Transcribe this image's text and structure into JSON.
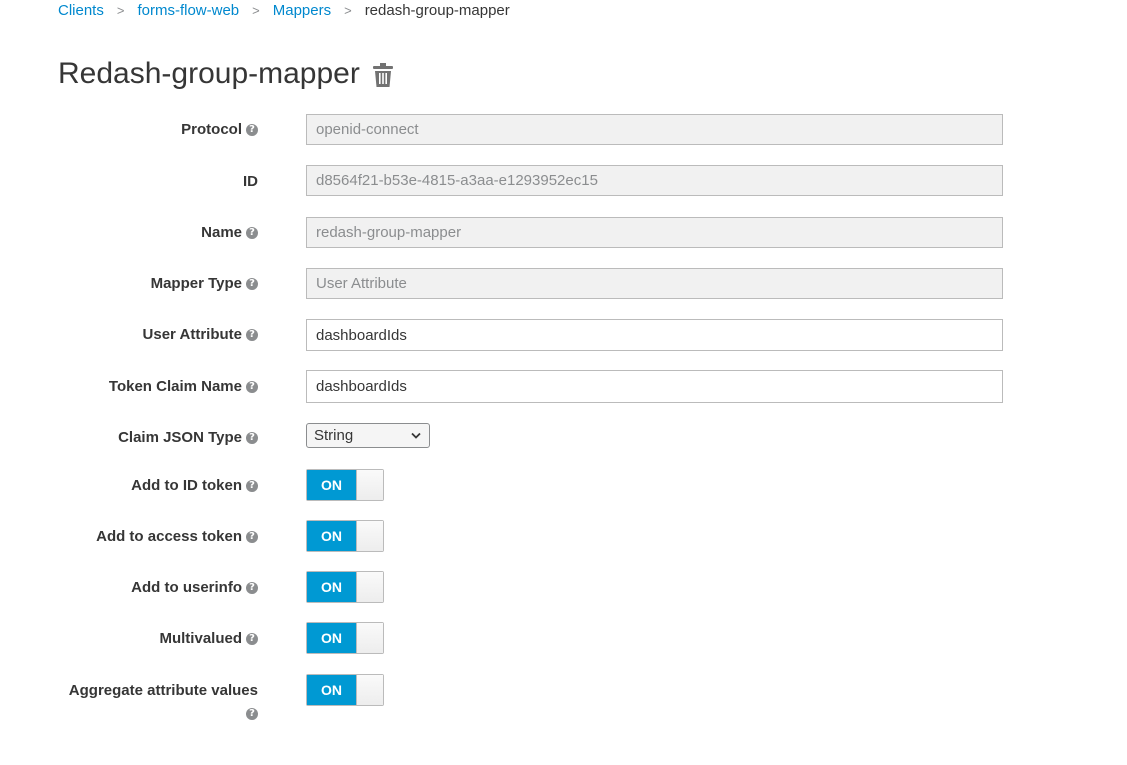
{
  "breadcrumb": {
    "items": [
      "Clients",
      "forms-flow-web",
      "Mappers"
    ],
    "current": "redash-group-mapper",
    "separator": ">"
  },
  "page": {
    "title": "Redash-group-mapper",
    "delete_icon": "trash-icon"
  },
  "form": {
    "protocol": {
      "label": "Protocol",
      "value": "openid-connect"
    },
    "id": {
      "label": "ID",
      "value": "d8564f21-b53e-4815-a3aa-e1293952ec15"
    },
    "name": {
      "label": "Name",
      "value": "redash-group-mapper"
    },
    "mapper_type": {
      "label": "Mapper Type",
      "value": "User Attribute"
    },
    "user_attribute": {
      "label": "User Attribute",
      "value": "dashboardIds"
    },
    "token_claim_name": {
      "label": "Token Claim Name",
      "value": "dashboardIds"
    },
    "claim_json_type": {
      "label": "Claim JSON Type",
      "value": "String"
    },
    "add_to_id_token": {
      "label": "Add to ID token",
      "state": "ON"
    },
    "add_to_access_token": {
      "label": "Add to access token",
      "state": "ON"
    },
    "add_to_userinfo": {
      "label": "Add to userinfo",
      "state": "ON"
    },
    "multivalued": {
      "label": "Multivalued",
      "state": "ON"
    },
    "aggregate_attribute_values": {
      "label": "Aggregate attribute values",
      "state": "ON"
    }
  },
  "help_icon": "?",
  "colors": {
    "link": "#0088ce",
    "toggle_on": "#0099d3"
  }
}
